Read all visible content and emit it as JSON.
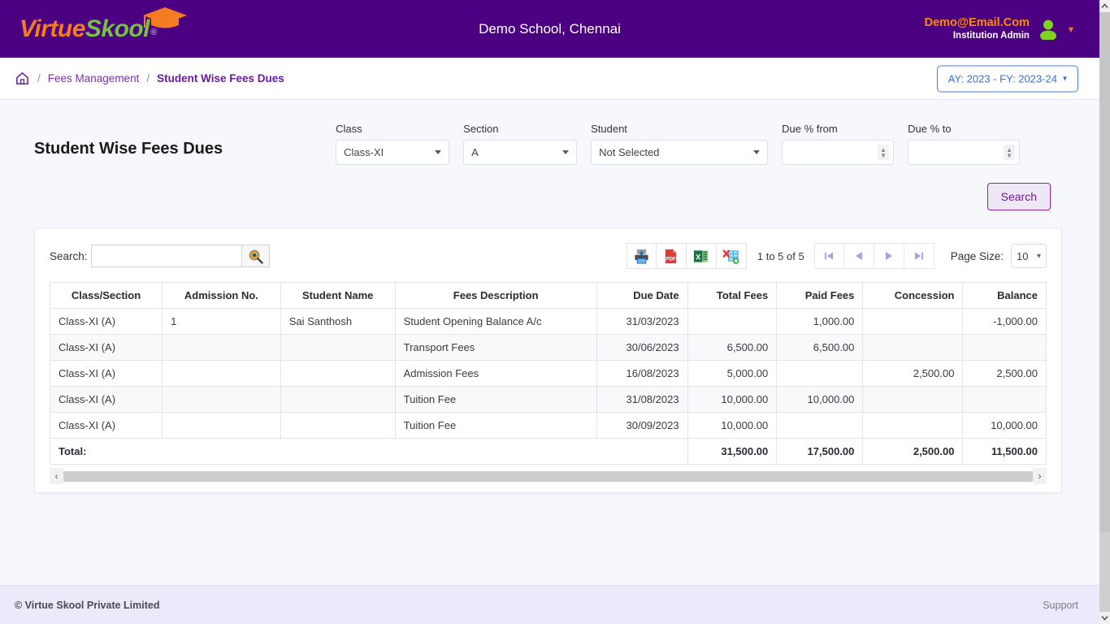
{
  "header": {
    "logo": {
      "part1": "Virtue",
      "part2": "Skool",
      "reg": "®"
    },
    "school_name": "Demo School, Chennai",
    "user_email": "Demo@Email.Com",
    "user_role": "Institution Admin"
  },
  "breadcrumb": {
    "home_icon": "home-icon",
    "sep": "/",
    "items": [
      {
        "label": "Fees Management"
      },
      {
        "label": "Student Wise Fees Dues"
      }
    ],
    "ay_selector": "AY: 2023 - FY: 2023-24"
  },
  "page": {
    "title": "Student Wise Fees Dues"
  },
  "filters": {
    "class": {
      "label": "Class",
      "value": "Class-XI"
    },
    "section": {
      "label": "Section",
      "value": "A"
    },
    "student": {
      "label": "Student",
      "value": "Not Selected"
    },
    "due_from": {
      "label": "Due % from",
      "value": "",
      "placeholder": ""
    },
    "due_to": {
      "label": "Due % to",
      "value": "",
      "placeholder": ""
    },
    "search_button": "Search"
  },
  "toolbar": {
    "search_label": "Search:",
    "search_value": "",
    "search_placeholder": "",
    "search_icon": "magnifier-icon",
    "export_buttons": [
      {
        "name": "print-icon",
        "label": "Print"
      },
      {
        "name": "pdf-icon",
        "label": "PDF"
      },
      {
        "name": "excel-icon",
        "label": "Excel"
      },
      {
        "name": "xml-export-icon",
        "label": "XML"
      }
    ],
    "range_text": "1 to 5 of 5",
    "pagination": [
      {
        "name": "first-page-button",
        "glyph": "first"
      },
      {
        "name": "prev-page-button",
        "glyph": "prev"
      },
      {
        "name": "next-page-button",
        "glyph": "next"
      },
      {
        "name": "last-page-button",
        "glyph": "last"
      }
    ],
    "page_size_label": "Page Size:",
    "page_size_value": "10"
  },
  "table": {
    "columns": [
      "Class/Section",
      "Admission No.",
      "Student Name",
      "Fees Description",
      "Due Date",
      "Total Fees",
      "Paid Fees",
      "Concession",
      "Balance"
    ],
    "rows": [
      {
        "class_section": "Class-XI (A)",
        "admission_no": "1",
        "student_name": "Sai Santhosh",
        "fees_description": "Student Opening Balance A/c",
        "due_date": "31/03/2023",
        "total_fees": "",
        "paid_fees": "1,000.00",
        "concession": "",
        "balance": "-1,000.00"
      },
      {
        "class_section": "Class-XI (A)",
        "admission_no": "",
        "student_name": "",
        "fees_description": "Transport Fees",
        "due_date": "30/06/2023",
        "total_fees": "6,500.00",
        "paid_fees": "6,500.00",
        "concession": "",
        "balance": ""
      },
      {
        "class_section": "Class-XI (A)",
        "admission_no": "",
        "student_name": "",
        "fees_description": "Admission Fees",
        "due_date": "16/08/2023",
        "total_fees": "5,000.00",
        "paid_fees": "",
        "concession": "2,500.00",
        "balance": "2,500.00"
      },
      {
        "class_section": "Class-XI (A)",
        "admission_no": "",
        "student_name": "",
        "fees_description": "Tuition Fee",
        "due_date": "31/08/2023",
        "total_fees": "10,000.00",
        "paid_fees": "10,000.00",
        "concession": "",
        "balance": ""
      },
      {
        "class_section": "Class-XI (A)",
        "admission_no": "",
        "student_name": "",
        "fees_description": "Tuition Fee",
        "due_date": "30/09/2023",
        "total_fees": "10,000.00",
        "paid_fees": "",
        "concession": "",
        "balance": "10,000.00"
      }
    ],
    "total_row": {
      "label": "Total:",
      "total_fees": "31,500.00",
      "paid_fees": "17,500.00",
      "concession": "2,500.00",
      "balance": "11,500.00"
    }
  },
  "footer": {
    "copyright": "© Virtue Skool Private Limited",
    "support": "Support"
  },
  "colors": {
    "brand_purple": "#4b0082",
    "logo_orange": "#f57c20",
    "logo_green": "#76c043",
    "link_blue": "#4a88e0",
    "accent_purple": "#6a1b9a",
    "ay_blue": "#3d6fd0",
    "footer_bg": "#ece9fb"
  }
}
